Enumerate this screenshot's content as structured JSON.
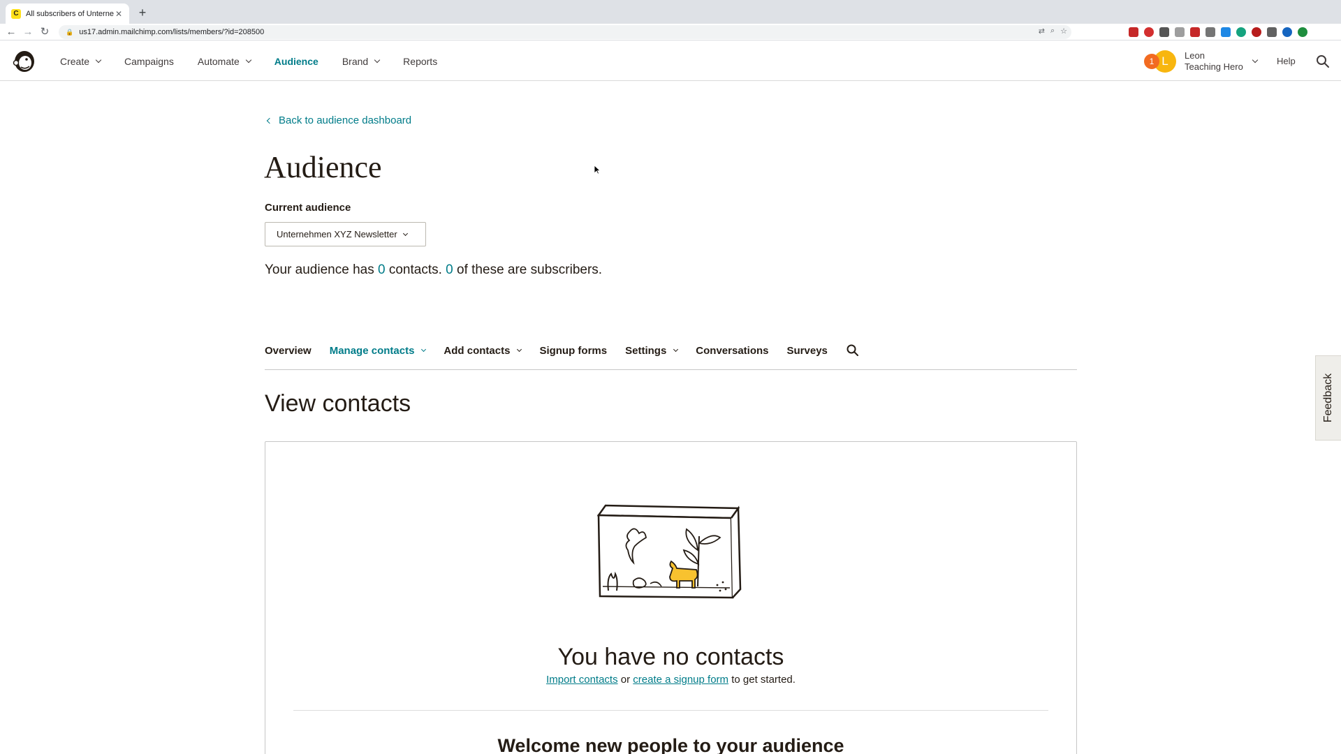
{
  "browser": {
    "tab_title": "All subscribers of Unternehmen XYZ Newsletter",
    "url": "us17.admin.mailchimp.com/lists/members/?id=208500"
  },
  "header": {
    "nav": [
      {
        "label": "Create",
        "dropdown": true
      },
      {
        "label": "Campaigns",
        "dropdown": false
      },
      {
        "label": "Automate",
        "dropdown": true
      },
      {
        "label": "Audience",
        "dropdown": false,
        "active": true
      },
      {
        "label": "Brand",
        "dropdown": true
      },
      {
        "label": "Reports",
        "dropdown": false
      }
    ],
    "notification_count": "1",
    "avatar_initial": "L",
    "user_name": "Leon",
    "user_org": "Teaching Hero",
    "help_label": "Help"
  },
  "page": {
    "back_label": "Back to audience dashboard",
    "title": "Audience",
    "current_audience_label": "Current audience",
    "selected_audience": "Unternehmen XYZ Newsletter",
    "summary": {
      "prefix": "Your audience has ",
      "contacts": "0",
      "middle": " contacts. ",
      "subscribers": "0",
      "suffix": " of these are subscribers."
    }
  },
  "subnav": [
    {
      "label": "Overview",
      "dropdown": false
    },
    {
      "label": "Manage contacts",
      "dropdown": true,
      "active": true
    },
    {
      "label": "Add contacts",
      "dropdown": true
    },
    {
      "label": "Signup forms",
      "dropdown": false
    },
    {
      "label": "Settings",
      "dropdown": true
    },
    {
      "label": "Conversations",
      "dropdown": false
    },
    {
      "label": "Surveys",
      "dropdown": false
    }
  ],
  "contacts": {
    "section_title": "View contacts",
    "empty_title": "You have no contacts",
    "import_link": "Import contacts",
    "or_text": " or ",
    "signup_link": "create a signup form",
    "suffix_text": " to get started.",
    "welcome_title": "Welcome new people to your audience"
  },
  "feedback_label": "Feedback",
  "colors": {
    "accent": "#007c89",
    "notification": "#f26b21",
    "avatar": "#f8b60f",
    "brand_yellow": "#ffe01b"
  }
}
